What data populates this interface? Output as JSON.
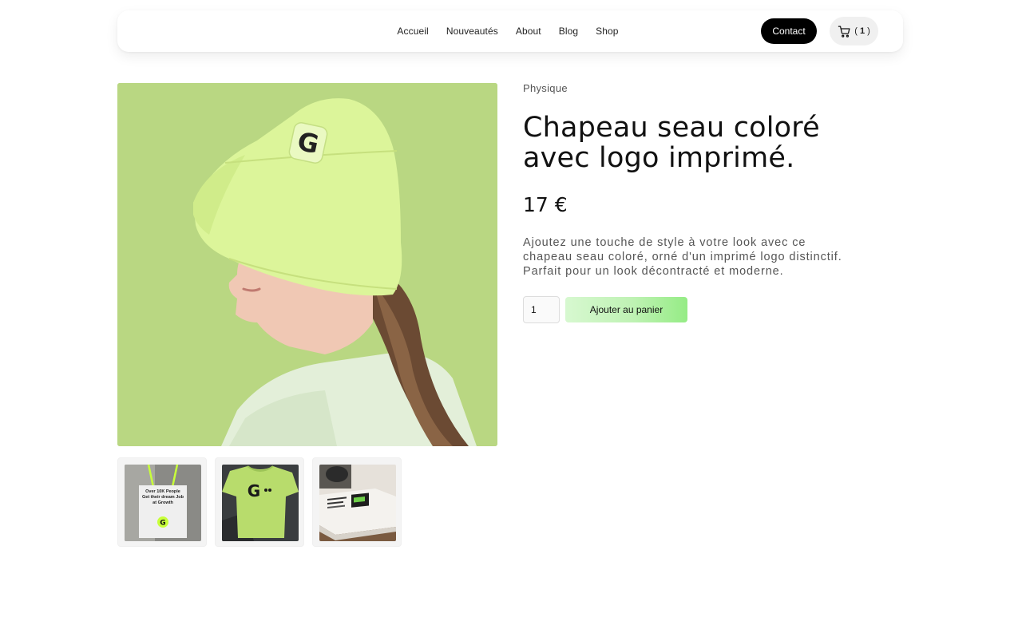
{
  "header": {
    "nav": [
      "Accueil",
      "Nouveautés",
      "About",
      "Blog",
      "Shop"
    ],
    "contact_label": "Contact",
    "cart": {
      "open": "( ",
      "count": "1",
      "close": " )"
    }
  },
  "product": {
    "category": "Physique",
    "title": "Chapeau seau coloré avec logo imprimé.",
    "price": "17 €",
    "description": "Ajoutez une touche de style à votre look avec ce chapeau seau coloré, orné d'un imprimé logo distinctif. Parfait pour un look décontracté et moderne.",
    "quantity": "1",
    "add_to_cart_label": "Ajouter au panier"
  },
  "images": {
    "main_logo_letter": "G",
    "thumbnails": [
      {
        "name": "tote-bag",
        "text": [
          "Over 10K People",
          "Get their dream Job",
          "at Growth"
        ],
        "logo_letter": "G"
      },
      {
        "name": "tshirt",
        "logo_letter": "G"
      },
      {
        "name": "books"
      }
    ]
  },
  "colors": {
    "accent_green": "#b9d782",
    "lime": "#dcf59a",
    "button_dark": "#000000"
  }
}
